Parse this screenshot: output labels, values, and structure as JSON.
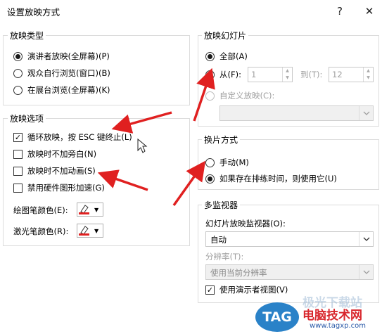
{
  "window": {
    "title": "设置放映方式",
    "help_glyph": "?",
    "close_glyph": "✕"
  },
  "show_type": {
    "title": "放映类型",
    "options": [
      {
        "label": "演讲者放映(全屏幕)(P)",
        "selected": true
      },
      {
        "label": "观众自行浏览(窗口)(B)",
        "selected": false
      },
      {
        "label": "在展台浏览(全屏幕)(K)",
        "selected": false
      }
    ]
  },
  "show_options": {
    "title": "放映选项",
    "checks": [
      {
        "label": "循环放映，按 ESC 键终止(L)",
        "checked": true
      },
      {
        "label": "放映时不加旁白(N)",
        "checked": false
      },
      {
        "label": "放映时不加动画(S)",
        "checked": false
      },
      {
        "label": "禁用硬件图形加速(G)",
        "checked": false
      }
    ],
    "pen_color_label": "绘图笔颜色(E):",
    "laser_color_label": "激光笔颜色(R):",
    "pen_color": "#e02020",
    "laser_color": "#e02020"
  },
  "show_slides": {
    "title": "放映幻灯片",
    "all_label": "全部(A)",
    "from_label": "从(F):",
    "from_value": "1",
    "to_label": "到(T):",
    "to_value": "12",
    "custom_label": "自定义放映(C):",
    "custom_value": ""
  },
  "advance": {
    "title": "换片方式",
    "manual_label": "手动(M)",
    "timings_label": "如果存在排练时间，则使用它(U)"
  },
  "multi_monitor": {
    "title": "多监视器",
    "monitor_label": "幻灯片放映监视器(O):",
    "monitor_value": "自动",
    "resolution_label": "分辨率(T):",
    "resolution_value": "使用当前分辨率",
    "presenter_view_label": "使用演示者视图(V)"
  },
  "watermark": {
    "badge": "TAG",
    "text": "电脑技术网",
    "url": "www.tagxp.com",
    "faded": "极光下载站"
  },
  "colors": {
    "arrow": "#e02020",
    "border": "#dcdcdc"
  }
}
